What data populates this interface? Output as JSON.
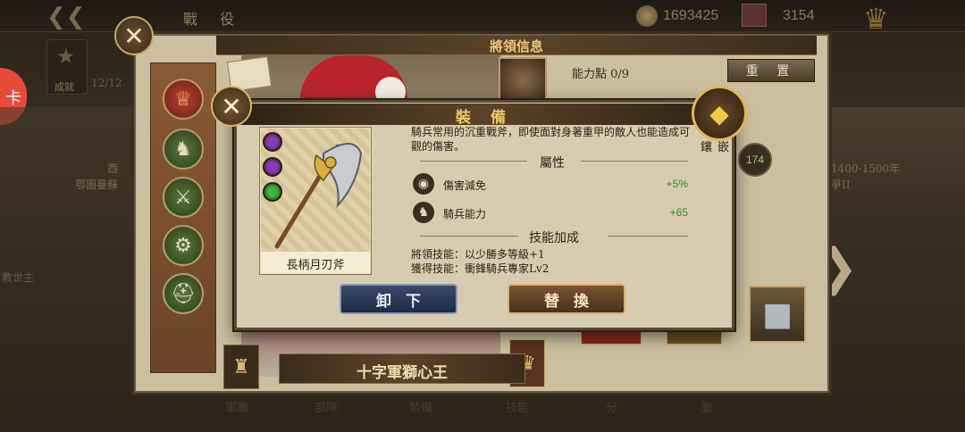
{
  "top_bar": {
    "title": "戰 役",
    "coins": "1693425",
    "gems": "3154"
  },
  "background": {
    "trophy_label": "成就",
    "trophy_count": "12/12",
    "left_text_1": "西",
    "left_text_2": "鄂圖曼蘇",
    "left_text_3": "教世主",
    "badge_text": "卡",
    "right_text_1": "1400-1500年",
    "right_text_2": "爭II",
    "side_number": "174",
    "bottom_tabs": [
      "軍團",
      "部隊",
      "裝備",
      "技能",
      "分",
      "面"
    ]
  },
  "general_panel": {
    "header": "將領信息",
    "ability_points": "能力點 0/9",
    "reset_label": "重 置",
    "general_name": "十字軍獅心王"
  },
  "equip_dialog": {
    "title": "裝 備",
    "inlay_label": "鑲嵌",
    "item_name": "長柄月刃斧",
    "description": "騎兵常用的沉重戰斧，即使面對身著重甲的敵人也能造成可觀的傷害。",
    "attributes_title": "屬性",
    "attributes": [
      {
        "label": "傷害減免",
        "value": "+5%",
        "icon": "shield-icon"
      },
      {
        "label": "騎兵能力",
        "value": "+65",
        "icon": "horse-icon"
      }
    ],
    "skills_title": "技能加成",
    "skills": [
      "將領技能：以少勝多等級+1",
      "獲得技能：衝鋒騎兵專家Lv2"
    ],
    "unequip_label": "卸下",
    "replace_label": "替換",
    "gem_colors": [
      "#8a3ab8",
      "#8a3ab8",
      "#3ab83a"
    ]
  },
  "colors": {
    "header_gold": "#e8c878",
    "positive_green": "#2e8a2e",
    "unequip_blue": "#2a3a5a",
    "replace_brown": "#6a4428"
  }
}
